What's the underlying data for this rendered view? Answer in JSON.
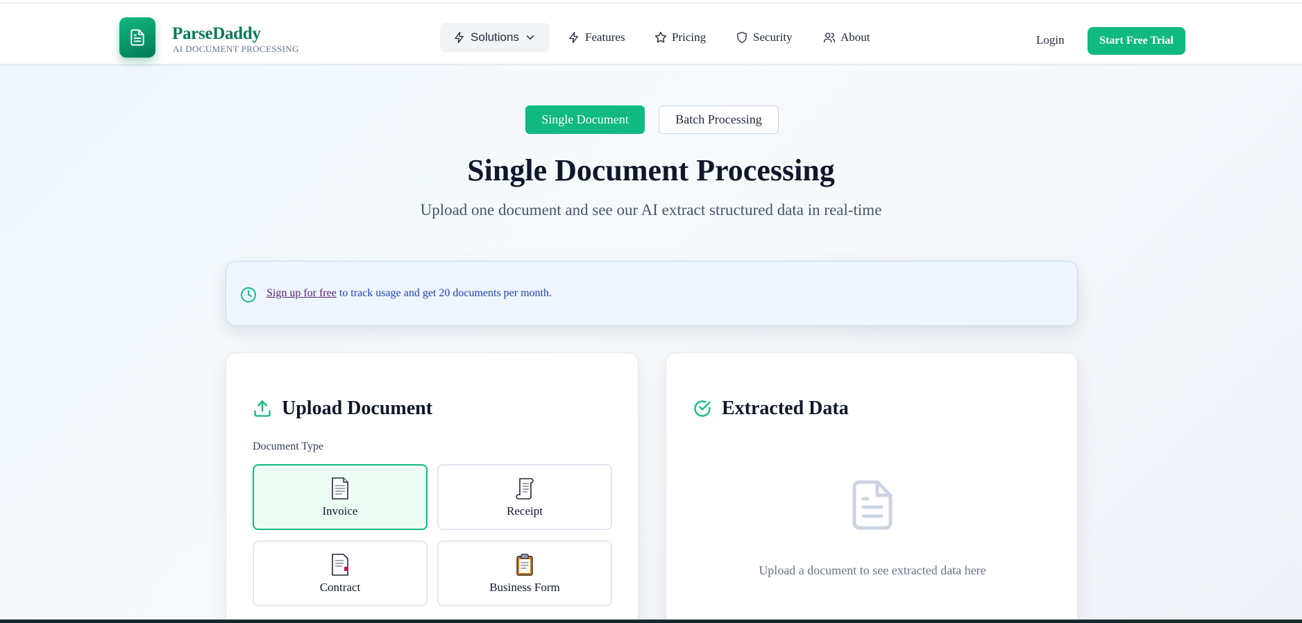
{
  "header": {
    "brand_name": "ParseDaddy",
    "brand_tagline": "AI DOCUMENT PROCESSING",
    "nav": {
      "solutions": "Solutions",
      "features": "Features",
      "pricing": "Pricing",
      "security": "Security",
      "about": "About"
    },
    "login_label": "Login",
    "trial_label": "Start Free Trial"
  },
  "mode_toggle": {
    "single_label": "Single Document",
    "batch_label": "Batch Processing",
    "active": "Single Document"
  },
  "hero": {
    "title": "Single Document Processing",
    "subtitle": "Upload one document and see our AI extract structured data in real-time"
  },
  "notice": {
    "link_text": "Sign up for free",
    "rest_text": " to track usage and get 20 documents per month."
  },
  "upload_card": {
    "title": "Upload Document",
    "doc_type_label": "Document Type",
    "doc_types": [
      {
        "label": "Invoice",
        "icon": "page-facing-up-icon",
        "selected": true
      },
      {
        "label": "Receipt",
        "icon": "scroll-icon",
        "selected": false
      },
      {
        "label": "Contract",
        "icon": "page-with-curl-icon",
        "selected": false
      },
      {
        "label": "Business Form",
        "icon": "clipboard-icon",
        "selected": false
      }
    ]
  },
  "extracted_card": {
    "title": "Extracted Data",
    "empty_message": "Upload a document to see extracted data here"
  },
  "colors": {
    "brand": "#10b981",
    "brand_dark": "#047857",
    "notice_bg": "#eef5fe",
    "selected_bg": "#ecfdf5"
  }
}
